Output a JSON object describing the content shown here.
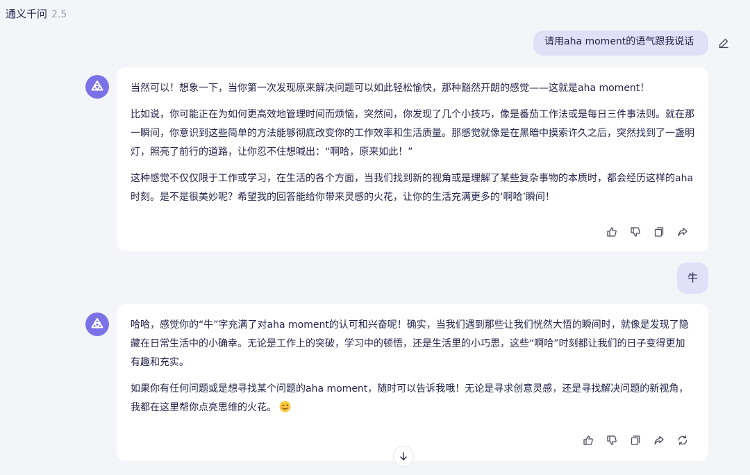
{
  "app": {
    "title": "通义千问",
    "version": "2.5"
  },
  "conversation": {
    "user_messages": [
      {
        "text": "请用aha moment的语气跟我说话"
      },
      {
        "text": "牛"
      }
    ],
    "replies": [
      {
        "paragraphs": [
          "当然可以！想象一下，当你第一次发现原来解决问题可以如此轻松愉快，那种豁然开朗的感觉——这就是aha moment！",
          "比如说，你可能正在为如何更高效地管理时间而烦恼，突然间，你发现了几个小技巧，像是番茄工作法或是每日三件事法则。就在那一瞬间，你意识到这些简单的方法能够彻底改变你的工作效率和生活质量。那感觉就像是在黑暗中摸索许久之后，突然找到了一盏明灯，照亮了前行的道路，让你忍不住想喊出：“啊哈，原来如此！”",
          "这种感觉不仅仅限于工作或学习，在生活的各个方面，当我们找到新的视角或是理解了某些复杂事物的本质时，都会经历这样的aha时刻。是不是很美妙呢？希望我的回答能给你带来灵感的火花，让你的生活充满更多的‘啊哈’瞬间！"
        ]
      },
      {
        "paragraphs": [
          "哈哈，感觉你的“牛”字充满了对aha moment的认可和兴奋呢！确实，当我们遇到那些让我们恍然大悟的瞬间时，就像是发现了隐藏在日常生活中的小确幸。无论是工作上的突破，学习中的顿悟，还是生活里的小巧思，这些“啊哈”时刻都让我们的日子变得更加有趣和充实。",
          "如果你有任何问题或是想寻找某个问题的aha moment，随时可以告诉我哦！无论是寻求创意灵感，还是寻找解决问题的新视角，我都在这里帮你点亮思维的火花。"
        ]
      }
    ]
  },
  "icons": {
    "edit": "pencil-icon",
    "like": "thumbs-up-icon",
    "dislike": "thumbs-down-icon",
    "copy": "copy-icon",
    "share": "share-icon",
    "regenerate": "refresh-icon",
    "scroll": "arrow-down-icon",
    "emoji": "wink-emoji-icon",
    "avatar": "qwen-logo-icon"
  },
  "colors": {
    "background": "#f4f5f9",
    "user_bubble": "#e0e1f8",
    "avatar": "#7c72e8",
    "text": "#26244c",
    "icon": "#4a4a5e"
  }
}
